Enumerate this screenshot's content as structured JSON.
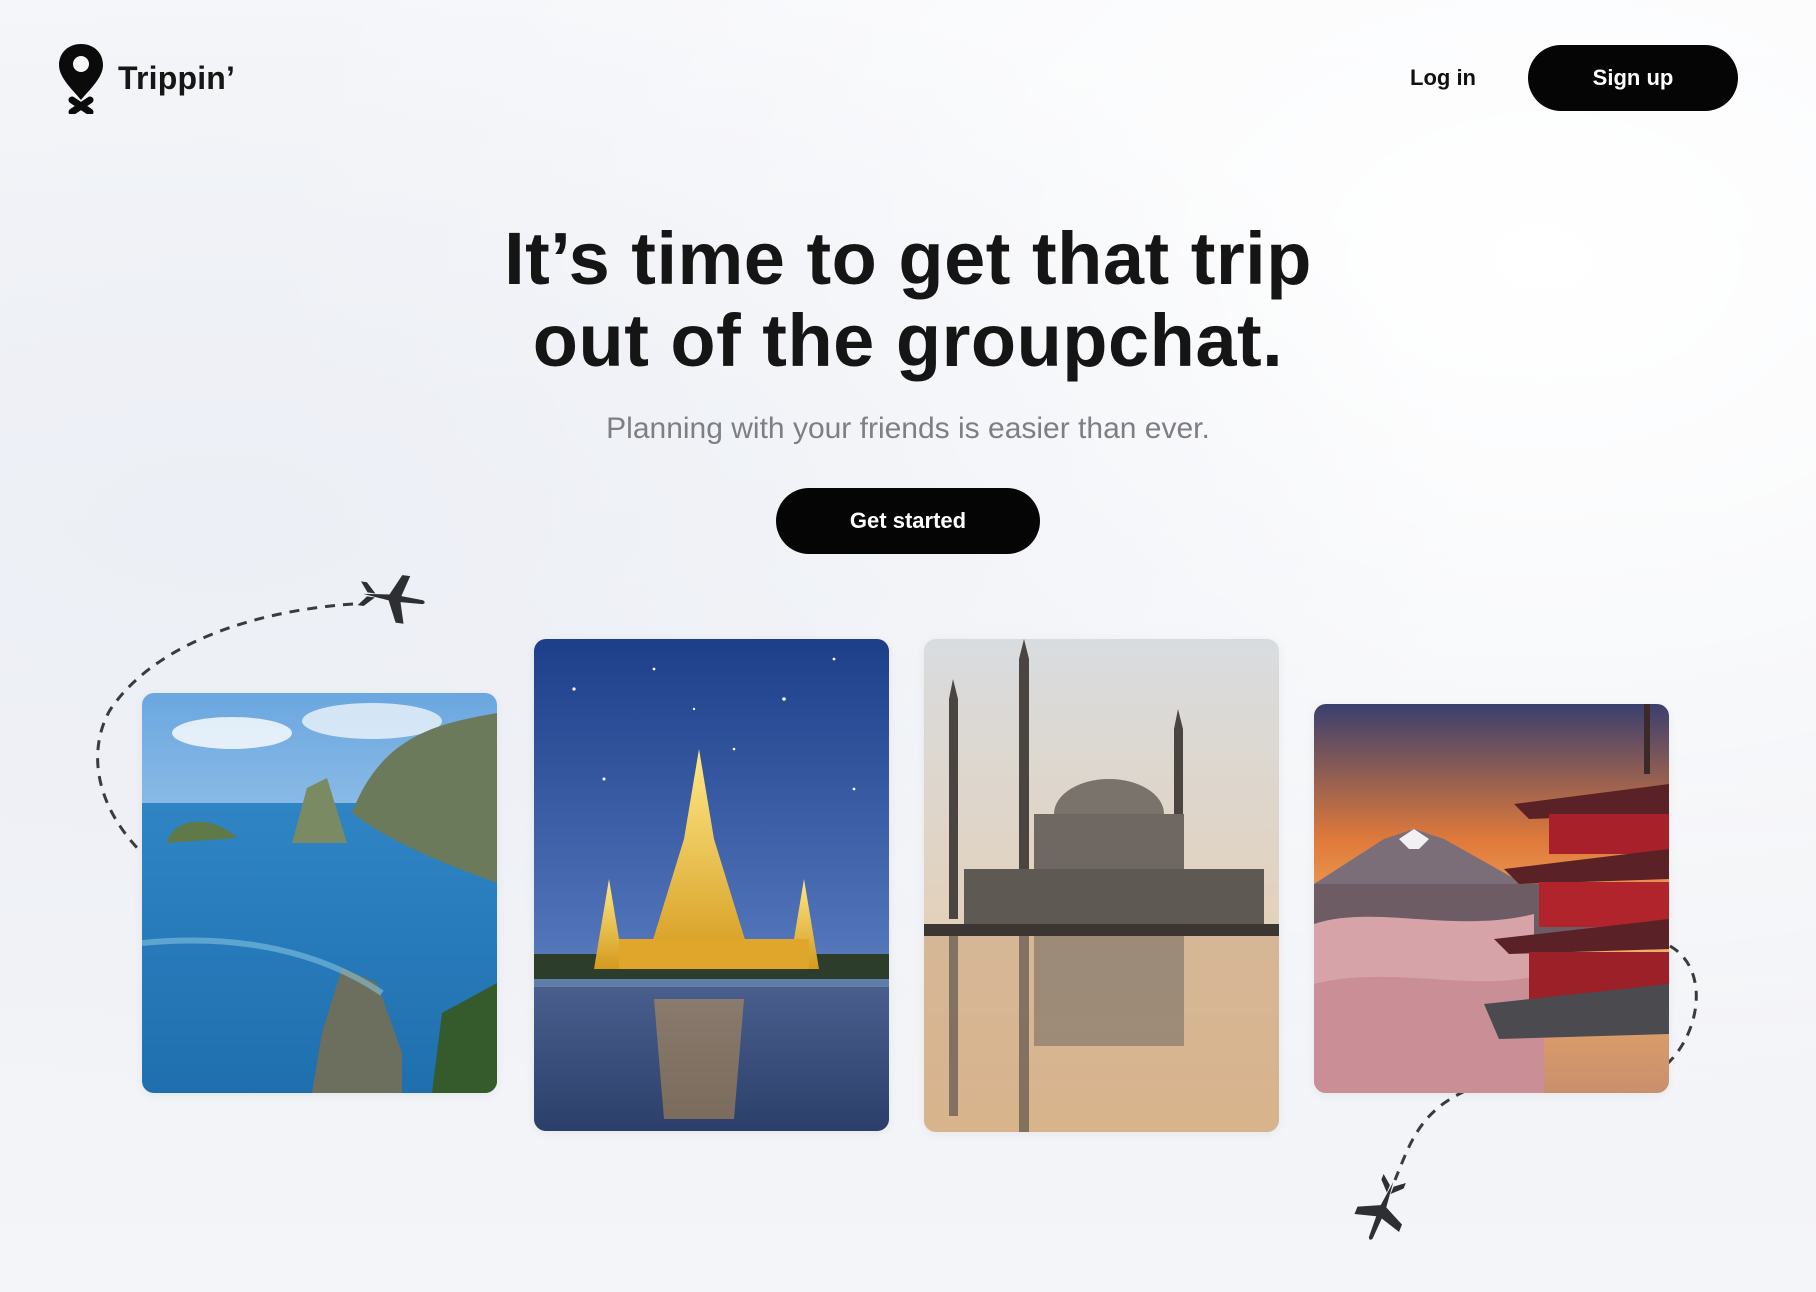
{
  "brand": {
    "name": "Trippin’",
    "logo_icon": "location-pin-icon"
  },
  "nav": {
    "login_label": "Log in",
    "signup_label": "Sign up"
  },
  "hero": {
    "headline_line1": "It’s time to get that trip",
    "headline_line2": "out of the groupchat.",
    "subheadline": "Planning with your friends is easier than ever.",
    "cta_label": "Get started"
  },
  "destinations": [
    {
      "scene": "tropical-coast-cliffs"
    },
    {
      "scene": "golden-temple-at-night"
    },
    {
      "scene": "domed-mosque-at-dusk"
    },
    {
      "scene": "pagoda-and-mountain-at-sunset"
    }
  ],
  "decorations": {
    "icons": [
      "airplane-icon",
      "airplane-icon"
    ],
    "path_style": "dashed-flight-path"
  },
  "colors": {
    "button_bg": "#050505",
    "button_text": "#ffffff",
    "headline": "#151515",
    "subheadline": "#7d7f85",
    "page_bg": "#f2f4f7"
  }
}
